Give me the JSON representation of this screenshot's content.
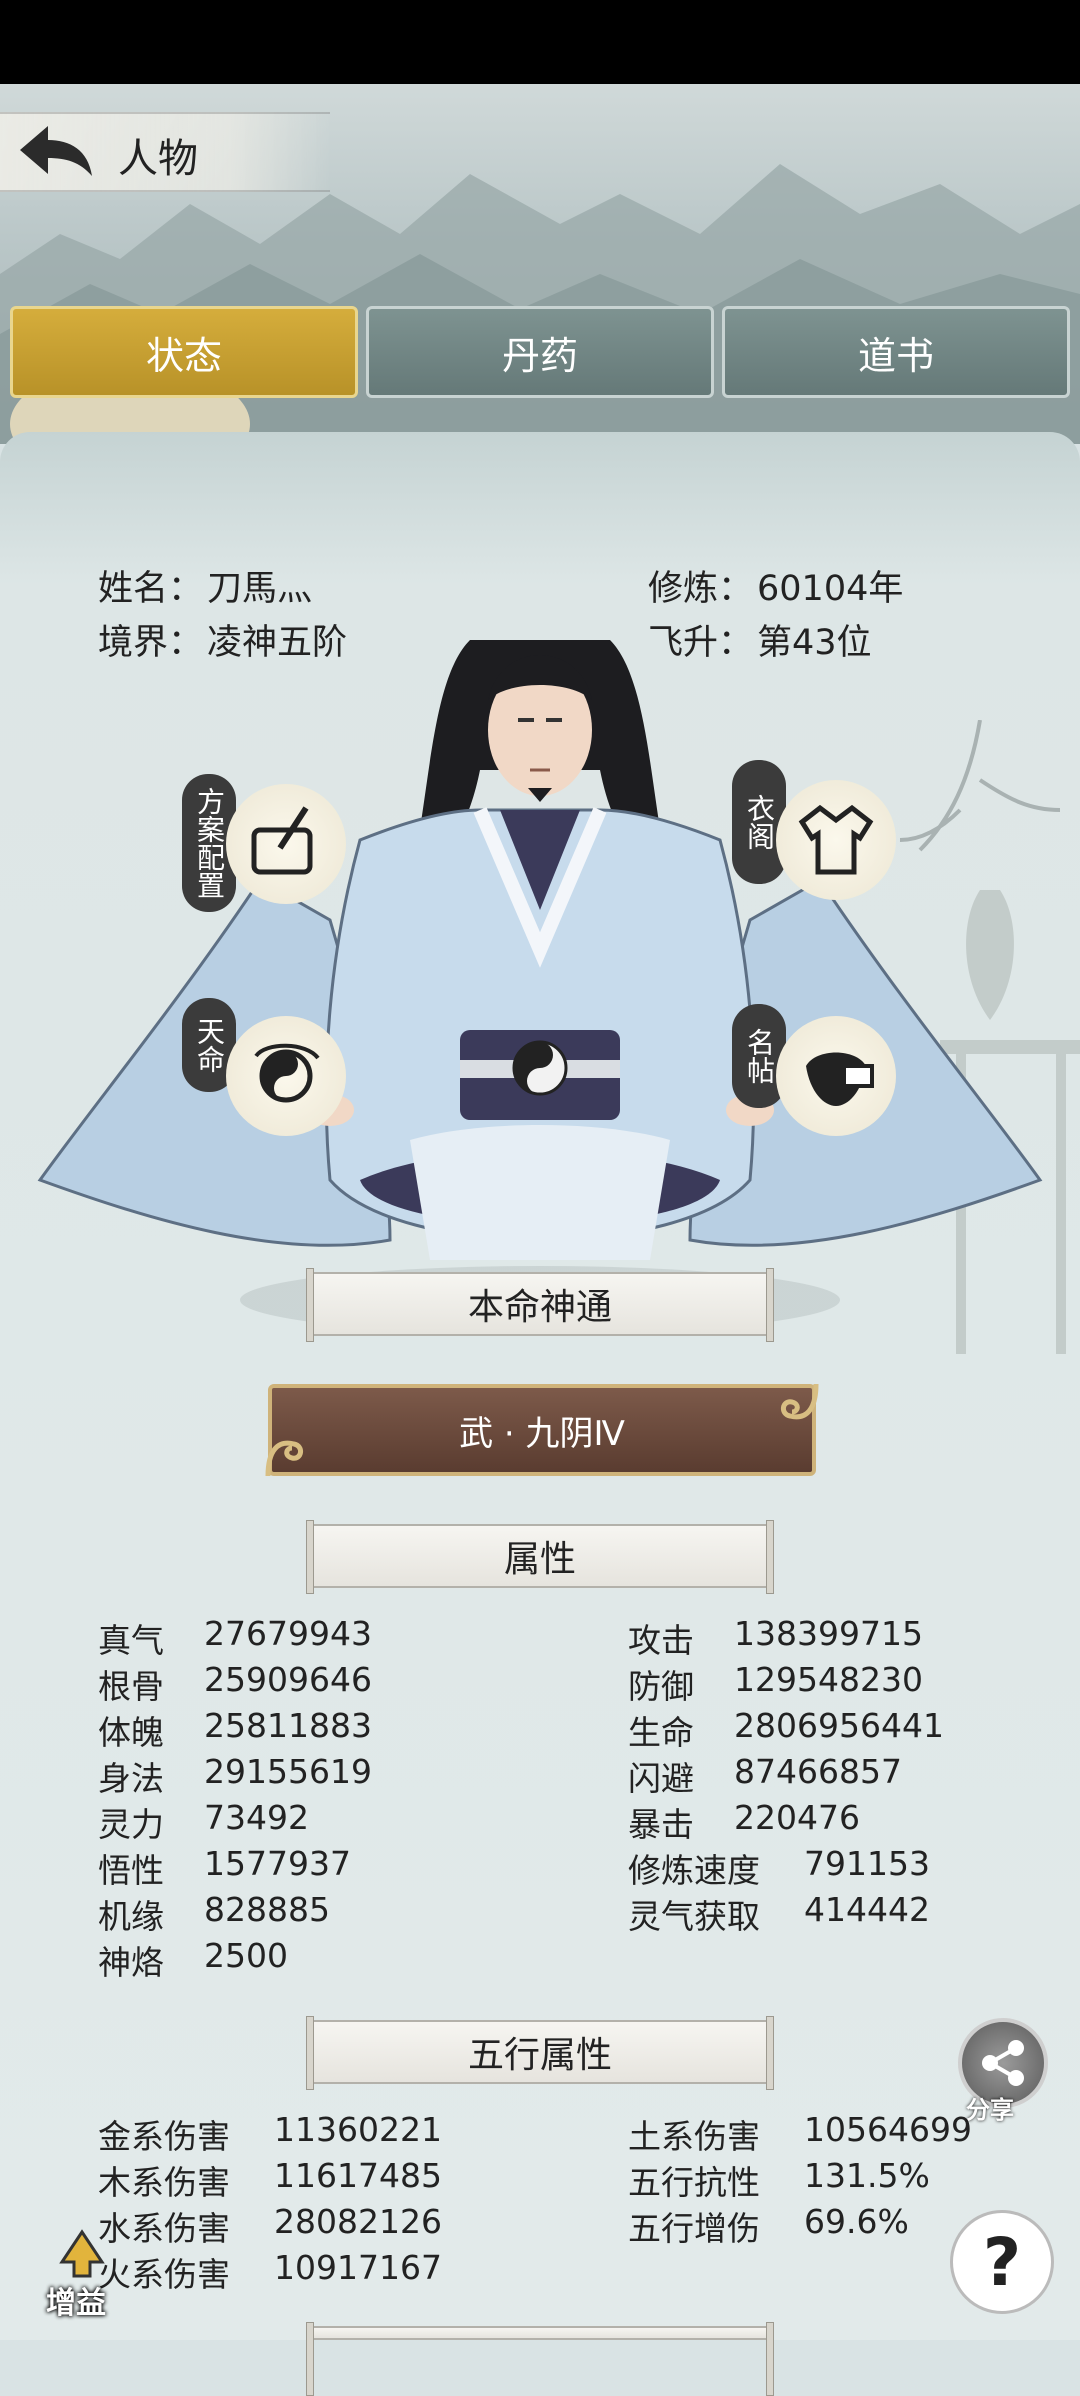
{
  "header": {
    "title": "人物"
  },
  "tabs": [
    {
      "label": "状态",
      "active": true
    },
    {
      "label": "丹药",
      "active": false
    },
    {
      "label": "道书",
      "active": false
    }
  ],
  "profile": {
    "name_label": "姓名：",
    "name": "刀馬灬",
    "realm_label": "境界：",
    "realm": "凌神五阶",
    "cultivation_label": "修炼：",
    "cultivation": "60104年",
    "ascension_label": "飞升：",
    "ascension": "第43位"
  },
  "side_buttons": {
    "plan": "方案配置",
    "wardrobe": "衣阁",
    "destiny": "天命",
    "card": "名帖"
  },
  "innate": {
    "header": "本命神通",
    "skill": "武 · 九阴Ⅳ"
  },
  "attributes": {
    "header": "属性",
    "left": [
      {
        "k": "真气",
        "v": "27679943"
      },
      {
        "k": "根骨",
        "v": "25909646"
      },
      {
        "k": "体魄",
        "v": "25811883"
      },
      {
        "k": "身法",
        "v": "29155619"
      },
      {
        "k": "灵力",
        "v": "73492"
      },
      {
        "k": "悟性",
        "v": "1577937"
      },
      {
        "k": "机缘",
        "v": "828885"
      },
      {
        "k": "神烙",
        "v": "2500"
      }
    ],
    "right": [
      {
        "k": "攻击",
        "v": "138399715"
      },
      {
        "k": "防御",
        "v": "129548230"
      },
      {
        "k": "生命",
        "v": "2806956441"
      },
      {
        "k": "闪避",
        "v": "87466857"
      },
      {
        "k": "暴击",
        "v": "220476"
      },
      {
        "k": "修炼速度",
        "v": "791153"
      },
      {
        "k": "灵气获取",
        "v": "414442"
      }
    ]
  },
  "elements": {
    "header": "五行属性",
    "left": [
      {
        "k": "金系伤害",
        "v": "11360221"
      },
      {
        "k": "木系伤害",
        "v": "11617485"
      },
      {
        "k": "水系伤害",
        "v": "28082126"
      },
      {
        "k": "火系伤害",
        "v": "10917167"
      }
    ],
    "right": [
      {
        "k": "土系伤害",
        "v": "10564699"
      },
      {
        "k": "五行抗性",
        "v": "131.5%"
      },
      {
        "k": "五行增伤",
        "v": "69.6%"
      }
    ]
  },
  "floating": {
    "share": "分享",
    "help": "?",
    "boost": "增益"
  },
  "colors": {
    "active_tab": "#c9a233",
    "inactive_tab": "#718786",
    "skill_button": "#6b4a3c"
  }
}
